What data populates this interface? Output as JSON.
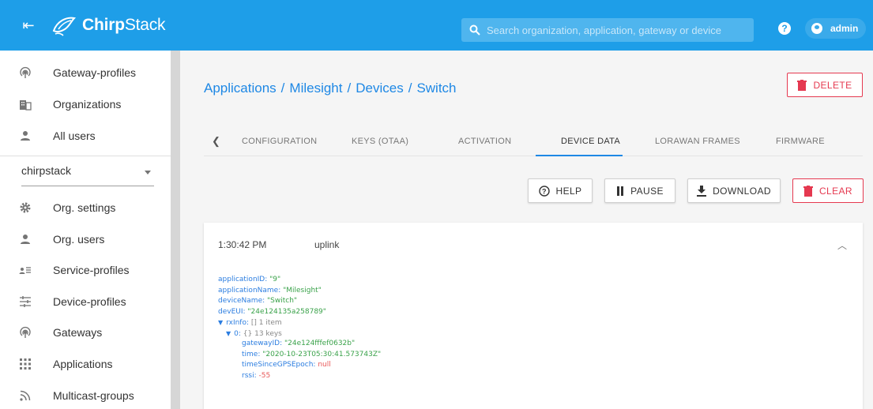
{
  "app": {
    "brand_bold": "Chirp",
    "brand_light": "Stack"
  },
  "topbar": {
    "search_placeholder": "Search organization, application, gateway or device",
    "user": "admin"
  },
  "sidebar": {
    "global_items": [
      {
        "label": "Gateway-profiles",
        "icon": "gateway-icon"
      },
      {
        "label": "Organizations",
        "icon": "building-icon"
      },
      {
        "label": "All users",
        "icon": "person-icon"
      }
    ],
    "org_select": "chirpstack",
    "org_items": [
      {
        "label": "Org. settings",
        "icon": "gear-icon"
      },
      {
        "label": "Org. users",
        "icon": "person-icon"
      },
      {
        "label": "Service-profiles",
        "icon": "service-icon"
      },
      {
        "label": "Device-profiles",
        "icon": "tune-icon"
      },
      {
        "label": "Gateways",
        "icon": "gateway-icon"
      },
      {
        "label": "Applications",
        "icon": "apps-icon"
      },
      {
        "label": "Multicast-groups",
        "icon": "rss-icon"
      }
    ]
  },
  "breadcrumb": [
    "Applications",
    "Milesight",
    "Devices",
    "Switch"
  ],
  "actions": {
    "delete": "DELETE"
  },
  "tabs": [
    "CONFIGURATION",
    "KEYS (OTAA)",
    "ACTIVATION",
    "DEVICE DATA",
    "LORAWAN FRAMES",
    "FIRMWARE"
  ],
  "toolbar": {
    "help": "HELP",
    "pause": "PAUSE",
    "download": "DOWNLOAD",
    "clear": "CLEAR"
  },
  "event": {
    "time": "1:30:42 PM",
    "type": "uplink",
    "fields": {
      "applicationID": {
        "key": "applicationID:",
        "value": "\"9\""
      },
      "applicationName": {
        "key": "applicationName:",
        "value": "\"Milesight\""
      },
      "deviceName": {
        "key": "deviceName:",
        "value": "\"Switch\""
      },
      "devEUI": {
        "key": "devEUI:",
        "value": "\"24e124135a258789\""
      },
      "rxInfo": {
        "key": "rxInfo:",
        "meta": "[] 1 item"
      },
      "rx0": {
        "key": "0:",
        "meta": "{} 13 keys"
      },
      "gatewayID": {
        "key": "gatewayID:",
        "value": "\"24e124fffef0632b\""
      },
      "time": {
        "key": "time:",
        "value": "\"2020-10-23T05:30:41.573743Z\""
      },
      "timeSinceGPSEpoch": {
        "key": "timeSinceGPSEpoch:",
        "value": "null"
      },
      "rssi": {
        "key": "rssi:",
        "value": "-55"
      }
    }
  },
  "colors": {
    "brand": "#1e9ee8",
    "accent": "#1e88e5",
    "danger": "#e53950",
    "json_key": "#2b7de0",
    "json_string": "#3aa24a",
    "json_number": "#e85858"
  }
}
